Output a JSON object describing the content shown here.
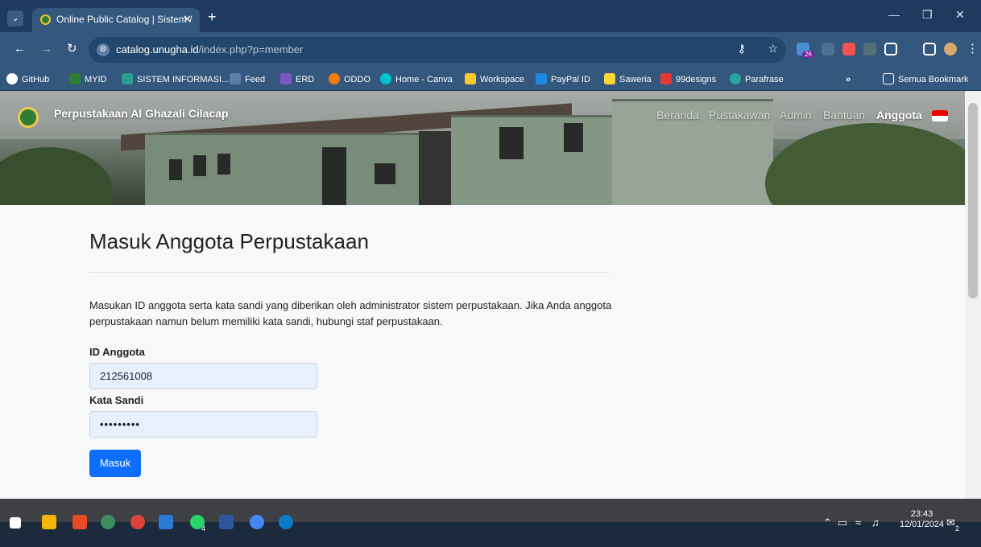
{
  "browser": {
    "tab_title": "Online Public Catalog | Sistem /",
    "url_host": "catalog.unugha.id",
    "url_path": "/index.php?p=member",
    "bookmarks": [
      {
        "label": "GitHub",
        "color": "#ffffff"
      },
      {
        "label": "MYID",
        "color": "#2e7d32"
      },
      {
        "label": "SISTEM INFORMASI...",
        "color": "#2a9d8f"
      },
      {
        "label": "Feed",
        "color": "#5b7fa6"
      },
      {
        "label": "ERD",
        "color": "#7e57c2"
      },
      {
        "label": "ODDO",
        "color": "#f57c00"
      },
      {
        "label": "Home - Canva",
        "color": "#00c4cc"
      },
      {
        "label": "Workspace",
        "color": "#ffca28"
      },
      {
        "label": "PayPal ID",
        "color": "#1e88e5"
      },
      {
        "label": "Saweria",
        "color": "#fdd835"
      },
      {
        "label": "99designs",
        "color": "#e53935"
      },
      {
        "label": "Parafrase",
        "color": "#26a69a"
      }
    ],
    "bookmark_folder": "Semua Bookmark",
    "extension_badge": "26"
  },
  "site": {
    "brand": "Perpustakaan Al Ghazali Cilacap",
    "menu": [
      "Beranda",
      "Pustakawan",
      "Admin",
      "Bantuan",
      "Anggota"
    ]
  },
  "login": {
    "heading": "Masuk Anggota Perpustakaan",
    "description": "Masukan ID anggota serta kata sandi yang diberikan oleh administrator sistem perpustakaan. Jika Anda anggota perpustakaan namun belum memiliki kata sandi, hubungi staf perpustakaan.",
    "id_label": "ID Anggota",
    "id_value": "212561008",
    "password_label": "Kata Sandi",
    "password_value": "•••••••••",
    "submit_label": "Masuk",
    "accent": "#0d6efd"
  },
  "taskbar": {
    "time": "23:43",
    "date": "12/01/2024",
    "whatsapp_badge": "4",
    "notifications": "2"
  }
}
